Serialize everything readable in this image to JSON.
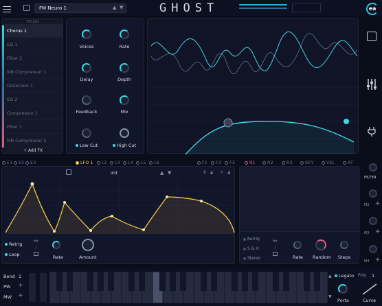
{
  "header": {
    "preset_name": "FM Neuro 1",
    "logo": "GHOST",
    "brand_initial": "ea"
  },
  "fx_list": {
    "title": "FX List",
    "items": [
      "Chorus 1",
      "EQ 1",
      "Filter 2",
      "MB Compressor 1",
      "Distortion 1",
      "EQ 2",
      "Compressor 1",
      "Filter 1",
      "MB Compressor 2"
    ],
    "add_label": "+ Add FX"
  },
  "chorus": {
    "knobs": [
      "Voices",
      "Rate",
      "Delay",
      "Depth",
      "Feedback",
      "Mix"
    ],
    "low_cut": "Low Cut",
    "high_cut": "High Cut"
  },
  "modulators_left": {
    "env_tabs": [
      "E1",
      "E2",
      "E3"
    ],
    "lfo_tabs": [
      "LFO 1",
      "L2",
      "L3",
      "L4",
      "L5",
      "L6"
    ],
    "f_tabs": [
      "F1",
      "F2",
      "F3"
    ],
    "shape_name": "init",
    "grid_x": "8",
    "grid_x_val": "4",
    "grid_y": "Y",
    "grid_y_val": "4",
    "retrig": "Retrig",
    "loop": "Loop",
    "hz": "Hz",
    "rate": "Rate",
    "amount": "Amount"
  },
  "modulators_right": {
    "tabs": [
      "R1",
      "R2",
      "R3",
      "KEY",
      "VEL",
      "AT"
    ],
    "retrig": "Retrig",
    "sh": "S & H",
    "stereo": "Stereo",
    "hz": "Hz",
    "rate": "Rate",
    "random": "Random",
    "steps": "Steps"
  },
  "side": {
    "filter": "FILTER",
    "m2": "M2",
    "m3": "M3",
    "m4": "M4"
  },
  "footer": {
    "bend": "Bend",
    "bend_val": "1",
    "pw": "PW",
    "mw": "MW",
    "legato": "Legato",
    "poly": "Poly",
    "poly_val": "1",
    "porta": "Porta",
    "curve": "Curve"
  },
  "colors": {
    "cyan": "#3fd8e2",
    "gold": "#f2c94c",
    "pink": "#e05b8b"
  }
}
